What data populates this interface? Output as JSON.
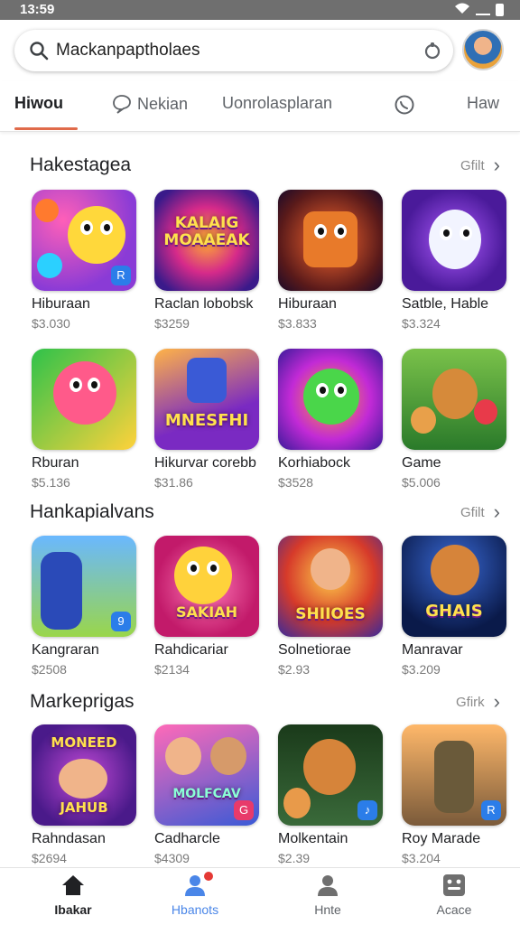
{
  "status_bar": {
    "time": "13:59"
  },
  "search": {
    "value": "Mackanpaptholaes"
  },
  "tabs": [
    {
      "label": "Hiwou",
      "active": true
    },
    {
      "label": "Nekian",
      "icon": "chat-bubble-icon"
    },
    {
      "label": "Uonrolasplaran"
    },
    {
      "label": "",
      "icon": "whatsapp-icon"
    },
    {
      "label": "Haw"
    }
  ],
  "sections": [
    {
      "title": "Hakestagea",
      "more": "Gfilt",
      "apps": [
        {
          "name": "Hiburaan",
          "price": "$3.030"
        },
        {
          "name": "Raclan lobobsk",
          "price": "$3259"
        },
        {
          "name": "Hiburaan",
          "price": "$3.833"
        },
        {
          "name": "Satble, Hable",
          "price": "$3.324"
        },
        {
          "name": "Rburan",
          "price": "$5.136"
        },
        {
          "name": "Hikurvar corebb",
          "price": "$31.86"
        },
        {
          "name": "Korhiabock",
          "price": "$3528"
        },
        {
          "name": "Game",
          "price": "$5.006"
        }
      ]
    },
    {
      "title": "Hankapialvans",
      "more": "Gfilt",
      "apps": [
        {
          "name": "Kangraran",
          "price": "$2508"
        },
        {
          "name": "Rahdicariar",
          "price": "$2134"
        },
        {
          "name": "Solnetiorae",
          "price": "$2.93"
        },
        {
          "name": "Manravar",
          "price": "$3.209"
        }
      ]
    },
    {
      "title": "Markeprigas",
      "more": "Gfirk",
      "apps": [
        {
          "name": "Rahndasan",
          "price": "$2694"
        },
        {
          "name": "Cadharcle",
          "price": "$4309"
        },
        {
          "name": "Molkentain",
          "price": "$2.39"
        },
        {
          "name": "Roy Marade",
          "price": "$3.204"
        }
      ]
    }
  ],
  "icon_art": {
    "kalaig": "KALAIG MOAAEAK",
    "mesfhi": "MNESFHI",
    "sakiah": "SAKIAH",
    "shhoes": "SHIIOES",
    "ghais": "GHAIS",
    "moneed": "MONEED",
    "jahub": "JAHUB",
    "molfcav": "MOLFCAV"
  },
  "bottom_nav": [
    {
      "label": "Ibakar",
      "icon": "home-icon",
      "active": true
    },
    {
      "label": "Hbanots",
      "icon": "people-icon",
      "badge": true
    },
    {
      "label": "Hnte",
      "icon": "person-icon"
    },
    {
      "label": "Acace",
      "icon": "apps-icon"
    }
  ]
}
